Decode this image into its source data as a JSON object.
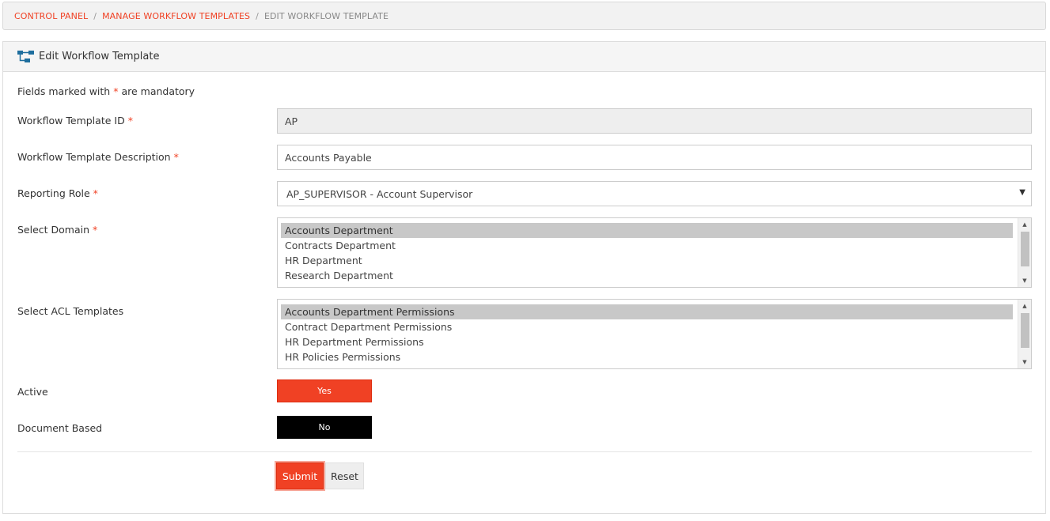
{
  "breadcrumb": {
    "items": [
      "CONTROL PANEL",
      "MANAGE WORKFLOW TEMPLATES"
    ],
    "separator": "/",
    "current": "EDIT WORKFLOW TEMPLATE"
  },
  "panel": {
    "title": "Edit Workflow Template",
    "icon": "workflow-icon"
  },
  "form": {
    "note_prefix": "Fields marked with",
    "note_star": "*",
    "note_suffix": "are mandatory",
    "required_mark": "*",
    "template_id": {
      "label": "Workflow Template ID",
      "value": "AP"
    },
    "description": {
      "label": "Workflow Template Description",
      "value": "Accounts Payable"
    },
    "reporting_role": {
      "label": "Reporting Role",
      "value": "AP_SUPERVISOR - Account Supervisor",
      "arrow": "▼"
    },
    "domain": {
      "label": "Select Domain",
      "options": [
        "Accounts Department",
        "Contracts Department",
        "HR Department",
        "Research Department"
      ],
      "selected": "Accounts Department"
    },
    "acl": {
      "label": "Select ACL Templates",
      "options": [
        "Accounts Department Permissions",
        "Contract Department Permissions",
        "HR Department Permissions",
        "HR Policies Permissions"
      ],
      "selected": "Accounts Department Permissions"
    },
    "active": {
      "label": "Active",
      "value": "Yes"
    },
    "document_based": {
      "label": "Document Based",
      "value": "No"
    },
    "submit_label": "Submit",
    "reset_label": "Reset"
  },
  "colors": {
    "accent": "#f04124",
    "toggle_off": "#000000",
    "selected_option": "#c8c8c8"
  }
}
